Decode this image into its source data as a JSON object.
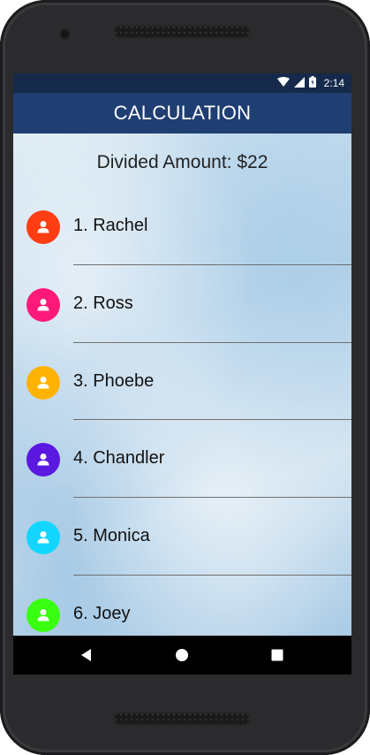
{
  "status_bar": {
    "time": "2:14",
    "icons": [
      "wifi-icon",
      "signal-icon",
      "battery-icon"
    ]
  },
  "app_bar": {
    "title": "CALCULATION",
    "color": "#1f3e72"
  },
  "summary": {
    "divided_amount": "Divided Amount: $22"
  },
  "people": [
    {
      "label": "1. Rachel",
      "color": "#ff3d12"
    },
    {
      "label": "2. Ross",
      "color": "#ff1a7a"
    },
    {
      "label": "3. Phoebe",
      "color": "#ffb300"
    },
    {
      "label": "4. Chandler",
      "color": "#5a18e0"
    },
    {
      "label": "5. Monica",
      "color": "#12d6ff"
    },
    {
      "label": "6. Joey",
      "color": "#39ff10"
    }
  ],
  "nav_bar": {
    "buttons": [
      "back-icon",
      "home-icon",
      "recents-icon"
    ]
  }
}
